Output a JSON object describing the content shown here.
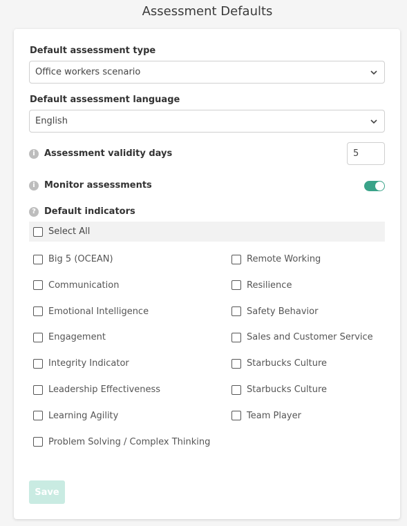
{
  "page": {
    "title": "Assessment Defaults"
  },
  "assessment_type": {
    "label": "Default assessment type",
    "value": "Office workers scenario",
    "icon": "chevron-down-icon"
  },
  "assessment_language": {
    "label": "Default assessment language",
    "value": "English",
    "icon": "chevron-down-icon"
  },
  "validity": {
    "label": "Assessment validity days",
    "value": "5",
    "icon_glyph": "i"
  },
  "monitor": {
    "label": "Monitor assessments",
    "enabled": true,
    "icon_glyph": "i",
    "toggle_color": "#3aa389"
  },
  "indicators": {
    "label": "Default indicators",
    "icon_glyph": "?",
    "select_all": "Select All",
    "left": [
      "Big 5 (OCEAN)",
      "Communication",
      "Emotional Intelligence",
      "Engagement",
      "Integrity Indicator",
      "Leadership Effectiveness",
      "Learning Agility",
      "Problem Solving / Complex Thinking"
    ],
    "right": [
      "Remote Working",
      "Resilience",
      "Safety Behavior",
      "Sales and Customer Service",
      "Starbucks Culture",
      "Starbucks Culture",
      "Team Player"
    ]
  },
  "actions": {
    "save": "Save",
    "save_color": "#c9ebe2"
  }
}
